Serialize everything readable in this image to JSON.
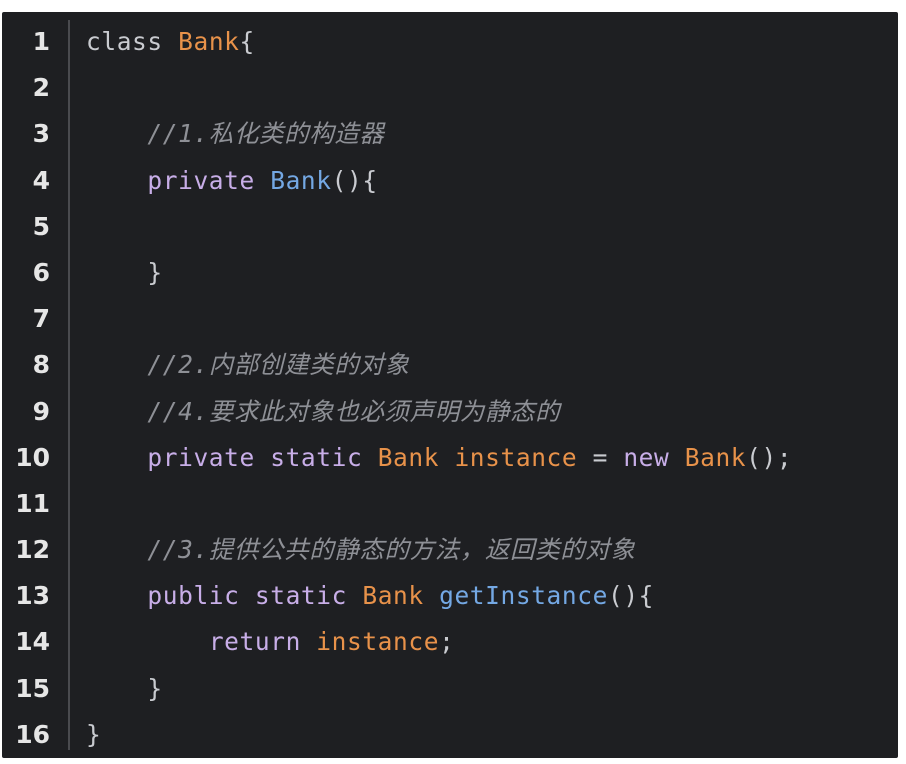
{
  "colors": {
    "background": "#1e1f22",
    "keyword": "#c8aee8",
    "type": "#e8924a",
    "function": "#74a8e4",
    "comment": "#8e9096",
    "text": "#c9cbd0",
    "line_number": "#e6e6e6"
  },
  "lines": [
    {
      "n": "1",
      "indent": "",
      "tokens": [
        {
          "t": "class",
          "c": "plain"
        },
        {
          "t": " ",
          "c": "plain"
        },
        {
          "t": "Bank",
          "c": "type"
        },
        {
          "t": "{",
          "c": "punct"
        }
      ]
    },
    {
      "n": "2",
      "indent": "",
      "tokens": []
    },
    {
      "n": "3",
      "indent": "    ",
      "tokens": [
        {
          "t": "//1.私化类的构造器",
          "c": "cmt"
        }
      ]
    },
    {
      "n": "4",
      "indent": "    ",
      "tokens": [
        {
          "t": "private",
          "c": "kw"
        },
        {
          "t": " ",
          "c": "plain"
        },
        {
          "t": "Bank",
          "c": "fn"
        },
        {
          "t": "(){",
          "c": "punct"
        }
      ]
    },
    {
      "n": "5",
      "indent": "",
      "tokens": []
    },
    {
      "n": "6",
      "indent": "    ",
      "tokens": [
        {
          "t": "}",
          "c": "punct"
        }
      ]
    },
    {
      "n": "7",
      "indent": "",
      "tokens": []
    },
    {
      "n": "8",
      "indent": "    ",
      "tokens": [
        {
          "t": "//2.内部创建类的对象",
          "c": "cmt"
        }
      ]
    },
    {
      "n": "9",
      "indent": "    ",
      "tokens": [
        {
          "t": "//4.要求此对象也必须声明为静态的",
          "c": "cmt"
        }
      ]
    },
    {
      "n": "10",
      "indent": "    ",
      "tokens": [
        {
          "t": "private",
          "c": "kw"
        },
        {
          "t": " ",
          "c": "plain"
        },
        {
          "t": "static",
          "c": "kw"
        },
        {
          "t": " ",
          "c": "plain"
        },
        {
          "t": "Bank",
          "c": "type"
        },
        {
          "t": " ",
          "c": "plain"
        },
        {
          "t": "instance",
          "c": "var"
        },
        {
          "t": " = ",
          "c": "punct"
        },
        {
          "t": "new",
          "c": "kw"
        },
        {
          "t": " ",
          "c": "plain"
        },
        {
          "t": "Bank",
          "c": "type"
        },
        {
          "t": "();",
          "c": "punct"
        }
      ]
    },
    {
      "n": "11",
      "indent": "",
      "tokens": []
    },
    {
      "n": "12",
      "indent": "    ",
      "tokens": [
        {
          "t": "//3.提供公共的静态的方法，返回类的对象",
          "c": "cmt"
        }
      ]
    },
    {
      "n": "13",
      "indent": "    ",
      "tokens": [
        {
          "t": "public",
          "c": "kw"
        },
        {
          "t": " ",
          "c": "plain"
        },
        {
          "t": "static",
          "c": "kw"
        },
        {
          "t": " ",
          "c": "plain"
        },
        {
          "t": "Bank",
          "c": "type"
        },
        {
          "t": " ",
          "c": "plain"
        },
        {
          "t": "getInstance",
          "c": "fn"
        },
        {
          "t": "(){",
          "c": "punct"
        }
      ]
    },
    {
      "n": "14",
      "indent": "        ",
      "tokens": [
        {
          "t": "return",
          "c": "kw"
        },
        {
          "t": " ",
          "c": "plain"
        },
        {
          "t": "instance",
          "c": "var"
        },
        {
          "t": ";",
          "c": "punct"
        }
      ]
    },
    {
      "n": "15",
      "indent": "    ",
      "tokens": [
        {
          "t": "}",
          "c": "punct"
        }
      ]
    },
    {
      "n": "16",
      "indent": "",
      "tokens": [
        {
          "t": "}",
          "c": "punct"
        }
      ]
    }
  ]
}
